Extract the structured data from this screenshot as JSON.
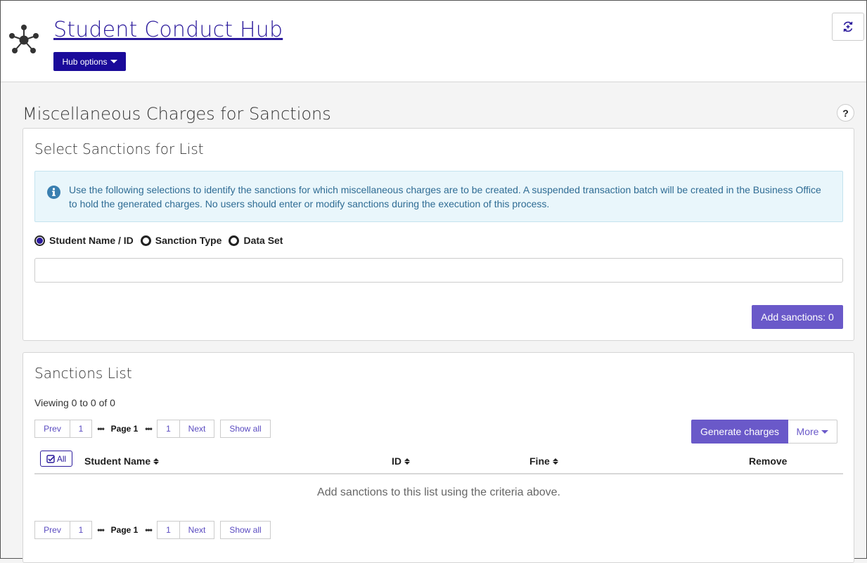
{
  "header": {
    "title": "Student Conduct Hub",
    "hub_options_label": "Hub options"
  },
  "page": {
    "title": "Miscellaneous Charges for Sanctions",
    "help_label": "?"
  },
  "select_panel": {
    "title": "Select Sanctions for List",
    "info_text": "Use the following selections to identify the sanctions for which miscellaneous charges are to be created. A suspended transaction batch will be created in the Business Office to hold the generated charges. No users should enter or modify sanctions during the execution of this process.",
    "radio_options": [
      {
        "label": "Student Name / ID",
        "checked": true
      },
      {
        "label": "Sanction Type",
        "checked": false
      },
      {
        "label": "Data Set",
        "checked": false
      }
    ],
    "search_value": "",
    "add_button_label": "Add sanctions: 0"
  },
  "list_panel": {
    "title": "Sanctions List",
    "viewing": "Viewing 0 to 0 of 0",
    "pager": {
      "prev": "Prev",
      "first_page": "1",
      "ellipsis": "•••",
      "current": "Page 1",
      "last_page": "1",
      "next": "Next",
      "show_all": "Show all"
    },
    "generate_label": "Generate charges",
    "more_label": "More",
    "all_label": "All",
    "columns": {
      "student_name": "Student Name",
      "id": "ID",
      "fine": "Fine",
      "remove": "Remove"
    },
    "empty_message": "Add sanctions to this list using the criteria above."
  },
  "colors": {
    "brand": "#1a0a9a",
    "accent": "#6a59c9",
    "info_bg": "#e9f6fb",
    "info_text": "#2f6c94"
  },
  "icons": [
    "hub-network-icon",
    "chevron-down-icon",
    "sync-add-icon",
    "info-icon",
    "check-square-icon",
    "sort-icon"
  ]
}
